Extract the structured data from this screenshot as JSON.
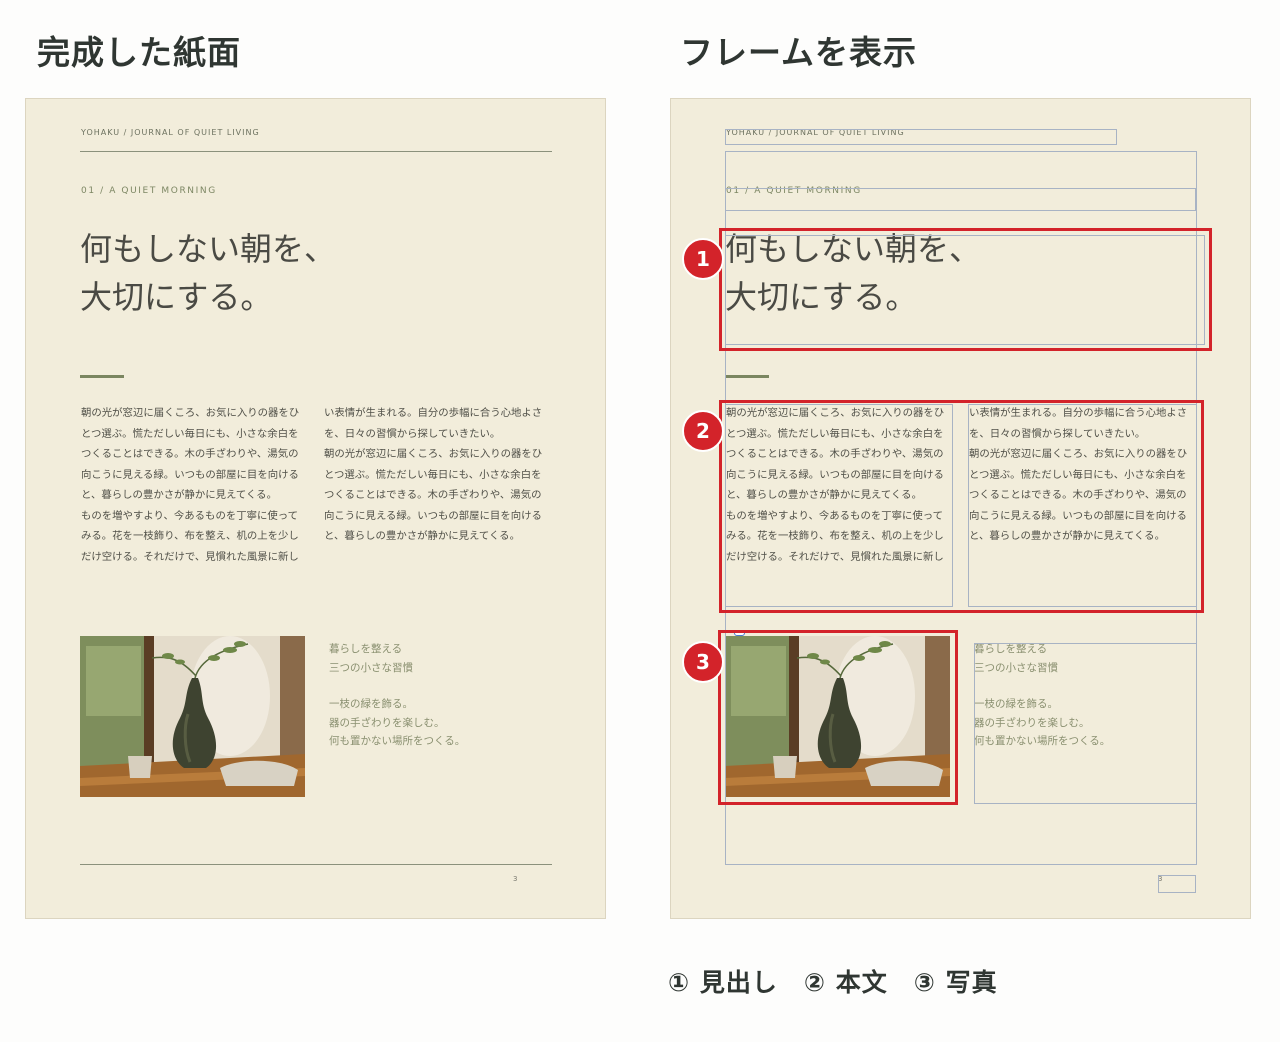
{
  "labels": {
    "finished": "完成した紙面",
    "frames": "フレームを表示"
  },
  "page": {
    "running_head": "YOHAKU / JOURNAL OF QUIET LIVING",
    "kicker": "01 / A QUIET MORNING",
    "headline_line1": "何もしない朝を、",
    "headline_line2": "大切にする。",
    "body_col1": "朝の光が窓辺に届くころ、お気に入りの器をひ\nとつ選ぶ。慌ただしい毎日にも、小さな余白を\nつくることはできる。木の手ざわりや、湯気の\n向こうに見える緑。いつもの部屋に目を向ける\nと、暮らしの豊かさが静かに見えてくる。\nものを増やすより、今あるものを丁寧に使って\nみる。花を一枝飾り、布を整え、机の上を少し\nだけ空ける。それだけで、見慣れた風景に新し",
    "body_col2": "い表情が生まれる。自分の歩幅に合う心地よさ\nを、日々の習慣から探していきたい。\n朝の光が窓辺に届くころ、お気に入りの器をひ\nとつ選ぶ。慌ただしい毎日にも、小さな余白を\nつくることはできる。木の手ざわりや、湯気の\n向こうに見える緑。いつもの部屋に目を向ける\nと、暮らしの豊かさが静かに見えてくる。",
    "caption_title1": "暮らしを整える",
    "caption_title2": "三つの小さな習慣",
    "caption_item1": "一枝の緑を飾る。",
    "caption_item2": "器の手ざわりを楽しむ。",
    "caption_item3": "何も置かない場所をつくる。",
    "page_number": "3"
  },
  "badges": [
    "1",
    "2",
    "3"
  ],
  "legend": "① 見出し　② 本文　③ 写真",
  "colors": {
    "paper": "#f2eddb",
    "accent_green": "#7b8660",
    "highlight_red": "#d3232a",
    "frame_blue": "#a8b3c4"
  },
  "icons": {
    "link_icon": "link-icon"
  }
}
